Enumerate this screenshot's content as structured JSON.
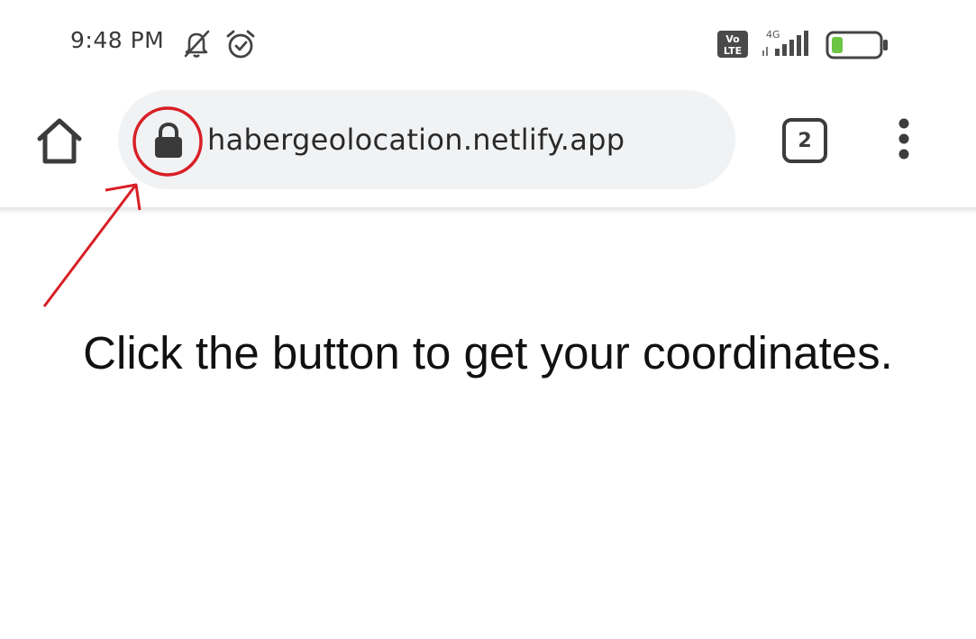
{
  "status_bar": {
    "time": "9:48 PM",
    "icons": [
      "bell-off-icon",
      "alarm-icon",
      "volte-icon",
      "signal-4g-icon",
      "battery-icon"
    ],
    "volte_top": "Vo",
    "volte_bottom": "LTE",
    "network_type": "4G",
    "battery_color": "#6cc644"
  },
  "toolbar": {
    "home_icon": "home-icon",
    "lock_icon": "lock-icon",
    "url": "habergeolocation.netlify.app",
    "tab_count": "2",
    "menu_icon": "more-vert-icon"
  },
  "annotation": {
    "color": "#d81f26"
  },
  "content": {
    "message": "Click the button to get your coordinates."
  }
}
